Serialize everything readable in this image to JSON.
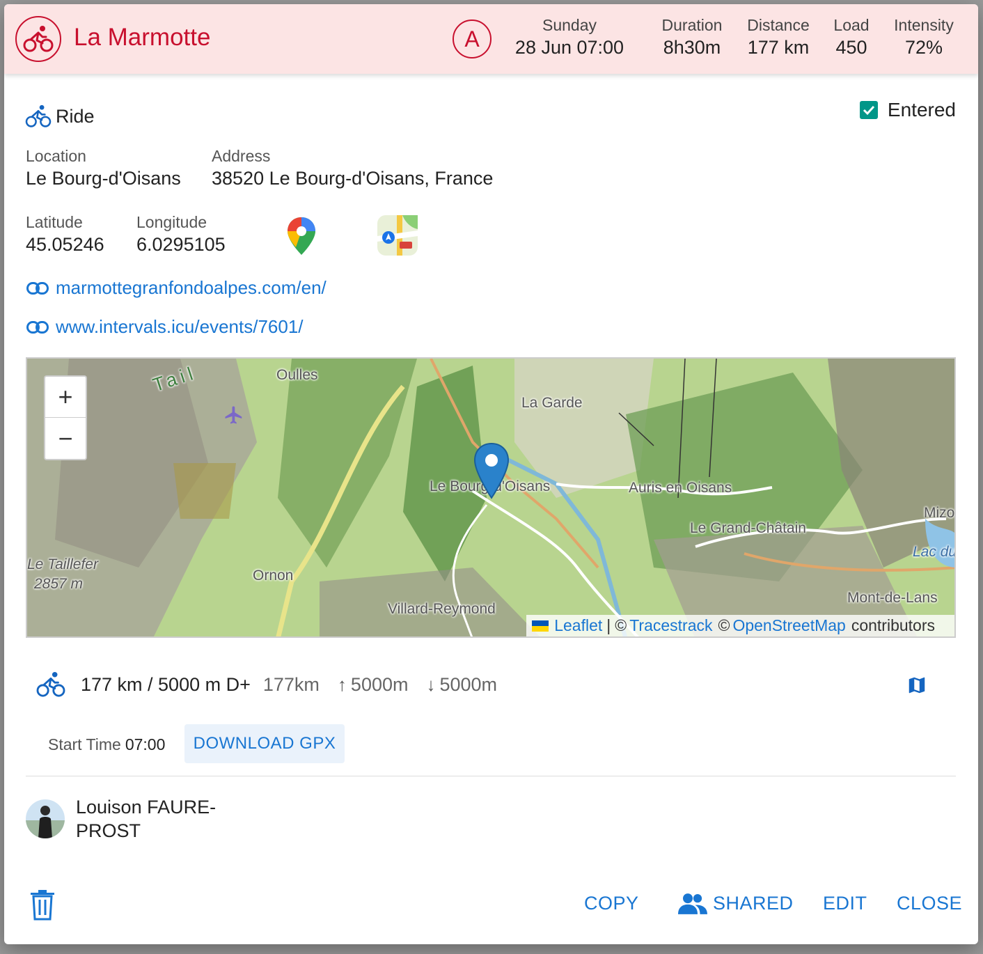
{
  "header": {
    "title": "La Marmotte",
    "priority": "A",
    "day": "Sunday",
    "date_time": "28 Jun 07:00",
    "duration_label": "Duration",
    "duration": "8h30m",
    "distance_label": "Distance",
    "distance": "177 km",
    "load_label": "Load",
    "load": "450",
    "intensity_label": "Intensity",
    "intensity": "72%"
  },
  "event": {
    "type": "Ride",
    "entered_label": "Entered",
    "entered": true
  },
  "location": {
    "location_label": "Location",
    "location": "Le Bourg-d'Oisans",
    "address_label": "Address",
    "address": "38520 Le Bourg-d'Oisans, France",
    "latitude_label": "Latitude",
    "latitude": "45.05246",
    "longitude_label": "Longitude",
    "longitude": "6.0295105"
  },
  "links": [
    "marmottegranfondoalpes.com/en/",
    "www.intervals.icu/events/7601/"
  ],
  "map": {
    "zoom_in": "+",
    "zoom_out": "−",
    "labels": [
      "Oulles",
      "La Garde",
      "Le Bourg-d'Oisans",
      "Auris en Oisans",
      "Le Grand-Châtain",
      "Mizo",
      "Lac du",
      "Le Taillefer",
      "2857 m",
      "Ornon",
      "Villard-Reymond",
      "Mont-de-Lans",
      "Tail"
    ],
    "attribution": {
      "leaflet": "Leaflet",
      "sep": "|",
      "copy1": "©",
      "tracestrack": "Tracestrack",
      "copy2": "©",
      "osm": "OpenStreetMap",
      "contributors": "contributors"
    }
  },
  "summary": {
    "main": "177 km / 5000 m D+",
    "distance": "177km",
    "ascent": "5000m",
    "descent": "5000m"
  },
  "start": {
    "label": "Start Time",
    "time": "07:00"
  },
  "download_label": "DOWNLOAD GPX",
  "athlete": {
    "name": "Louison FAURE-PROST"
  },
  "actions": {
    "copy": "COPY",
    "shared": "SHARED",
    "edit": "EDIT",
    "close": "CLOSE"
  },
  "colors": {
    "accent": "#c8102e",
    "link": "#1976d2",
    "header_bg": "#fce4e4",
    "check": "#009688"
  }
}
